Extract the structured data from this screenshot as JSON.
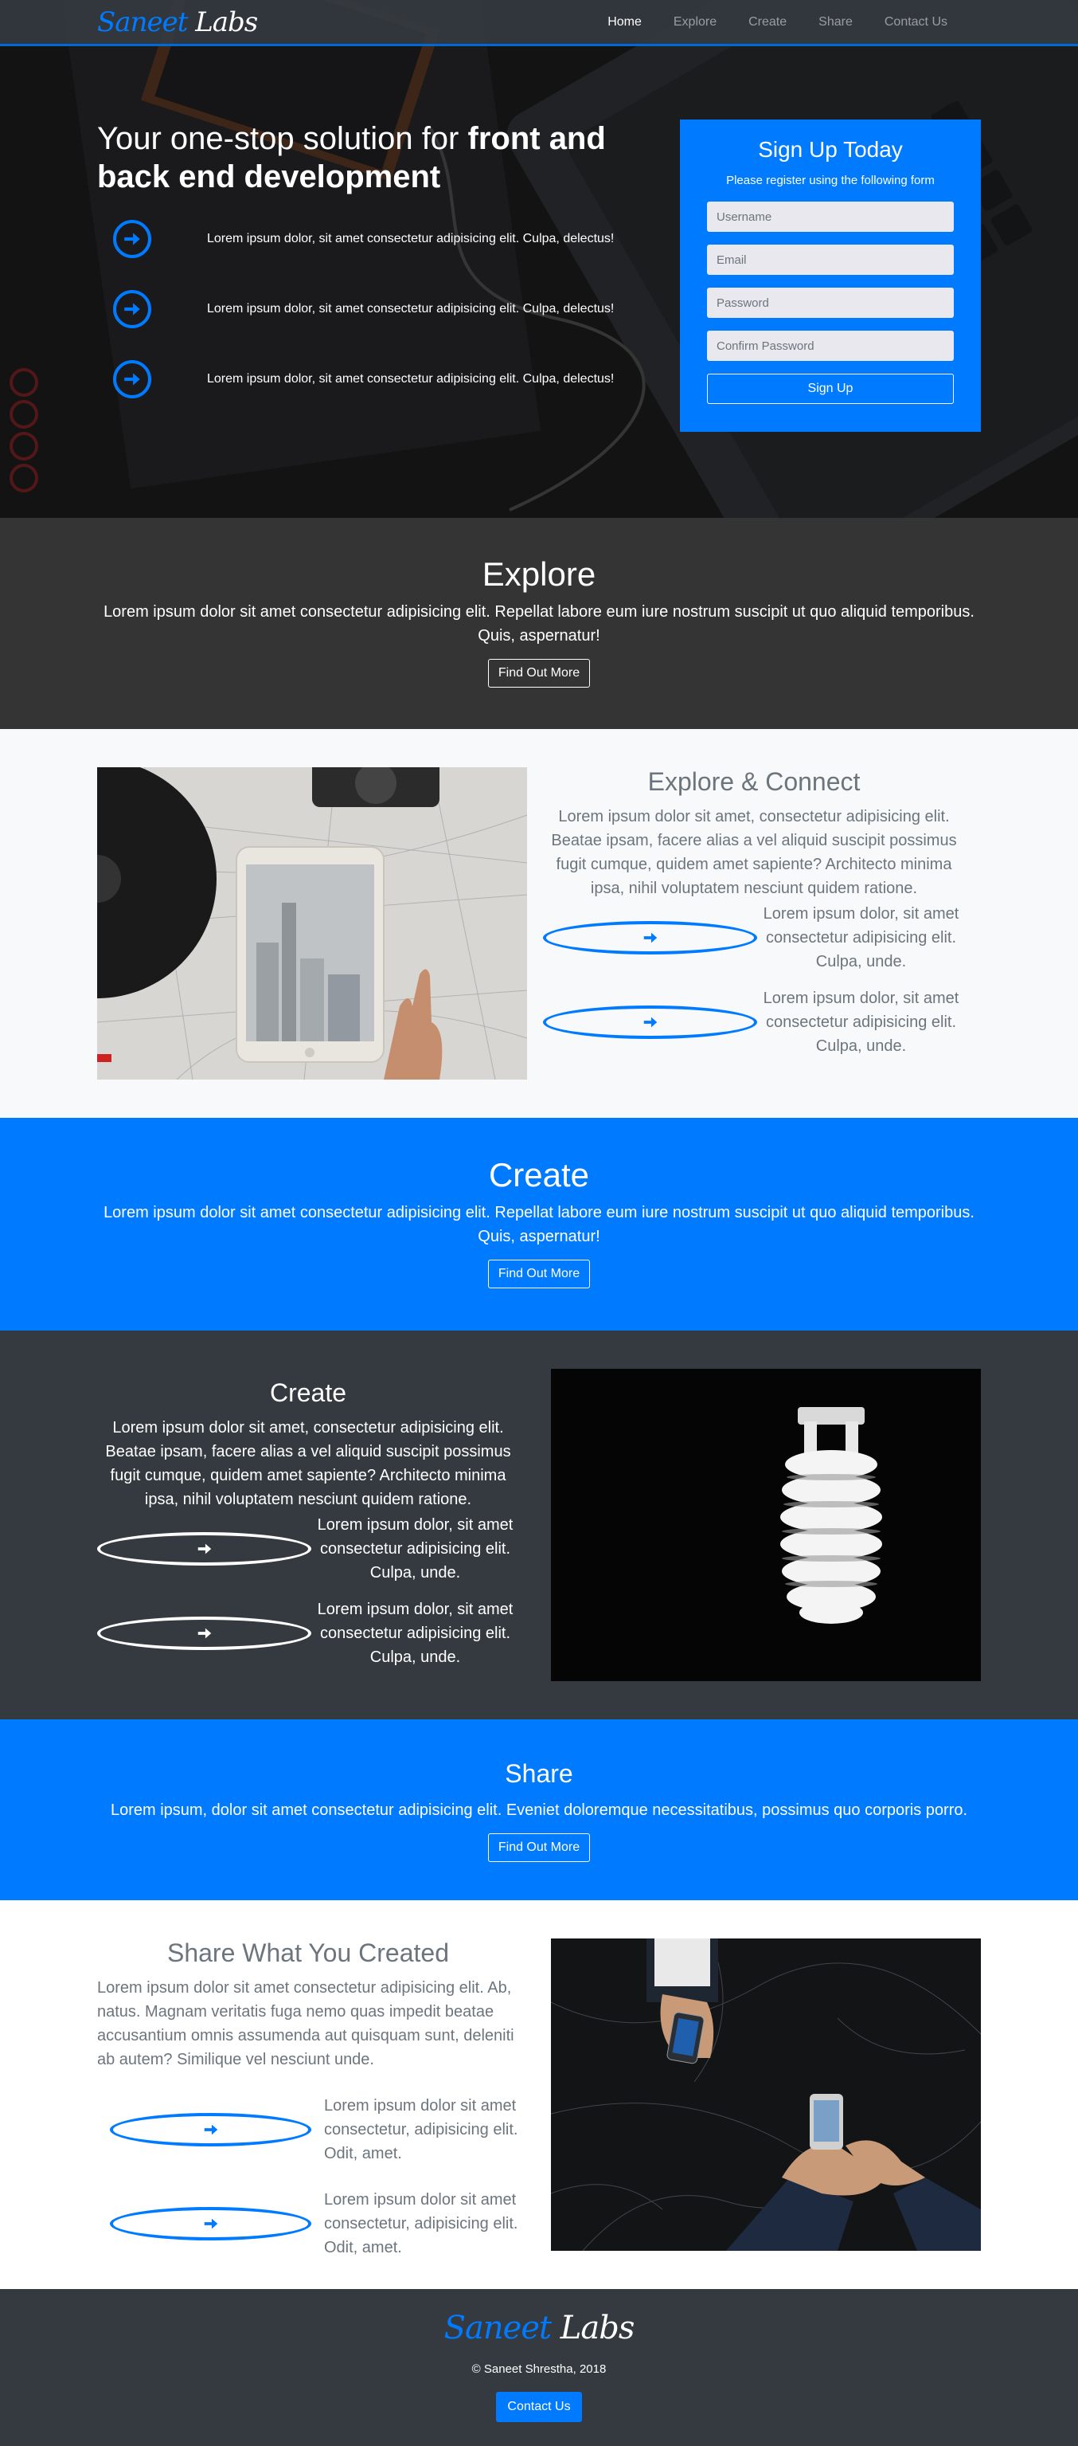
{
  "brand": {
    "first": "Saneet",
    "second": "Labs"
  },
  "nav": {
    "items": [
      "Home",
      "Explore",
      "Create",
      "Share",
      "Contact Us"
    ]
  },
  "hero": {
    "title_plain": "Your one-stop solution for ",
    "title_bold": "front and back end development",
    "items": [
      "Lorem ipsum dolor, sit amet consectetur adipisicing elit. Culpa, delectus!",
      "Lorem ipsum dolor, sit amet consectetur adipisicing elit. Culpa, delectus!",
      "Lorem ipsum dolor, sit amet consectetur adipisicing elit. Culpa, delectus!"
    ]
  },
  "signup": {
    "title": "Sign Up Today",
    "subtitle": "Please register using the following form",
    "username_placeholder": "Username",
    "email_placeholder": "Email",
    "password_placeholder": "Password",
    "confirm_placeholder": "Confirm Password",
    "button": "Sign Up"
  },
  "explore_band": {
    "title": "Explore",
    "text": "Lorem ipsum dolor sit amet consectetur adipisicing elit. Repellat labore eum iure nostrum suscipit ut quo aliquid temporibus. Quis, aspernatur!",
    "button": "Find Out More"
  },
  "explore_connect": {
    "title": "Explore & Connect",
    "text": "Lorem ipsum dolor sit amet, consectetur adipisicing elit. Beatae ipsam, facere alias a vel aliquid suscipit possimus fugit cumque, quidem amet sapiente? Architecto minima ipsa, nihil voluptatem nesciunt quidem ratione.",
    "items": [
      "Lorem ipsum dolor, sit amet consectetur adipisicing elit. Culpa, unde.",
      "Lorem ipsum dolor, sit amet consectetur adipisicing elit. Culpa, unde."
    ]
  },
  "create_band": {
    "title": "Create",
    "text": "Lorem ipsum dolor sit amet consectetur adipisicing elit. Repellat labore eum iure nostrum suscipit ut quo aliquid temporibus. Quis, aspernatur!",
    "button": "Find Out More"
  },
  "create_section": {
    "title": "Create",
    "text": "Lorem ipsum dolor sit amet, consectetur adipisicing elit. Beatae ipsam, facere alias a vel aliquid suscipit possimus fugit cumque, quidem amet sapiente? Architecto minima ipsa, nihil voluptatem nesciunt quidem ratione.",
    "items": [
      "Lorem ipsum dolor, sit amet consectetur adipisicing elit. Culpa, unde.",
      "Lorem ipsum dolor, sit amet consectetur adipisicing elit. Culpa, unde."
    ]
  },
  "share_band": {
    "title": "Share",
    "text": "Lorem ipsum, dolor sit amet consectetur adipisicing elit. Eveniet doloremque necessitatibus, possimus quo corporis porro.",
    "button": "Find Out More"
  },
  "share_section": {
    "title": "Share What You Created",
    "text": "Lorem ipsum dolor sit amet consectetur adipisicing elit. Ab, natus. Magnam veritatis fuga nemo quas impedit beatae accusantium omnis assumenda aut quisquam sunt, deleniti ab autem? Similique vel nesciunt unde.",
    "items": [
      "Lorem ipsum dolor sit amet consectetur, adipisicing elit. Odit, amet.",
      "Lorem ipsum dolor sit amet consectetur, adipisicing elit. Odit, amet."
    ]
  },
  "footer": {
    "copyright": "© Saneet Shrestha, 2018",
    "button": "Contact Us"
  },
  "colors": {
    "primary": "#007bff",
    "dark": "#343a40",
    "band_dark": "#343434",
    "light": "#f8f9fa"
  },
  "icons": {
    "bullet": "arrow-circle-right-icon"
  }
}
